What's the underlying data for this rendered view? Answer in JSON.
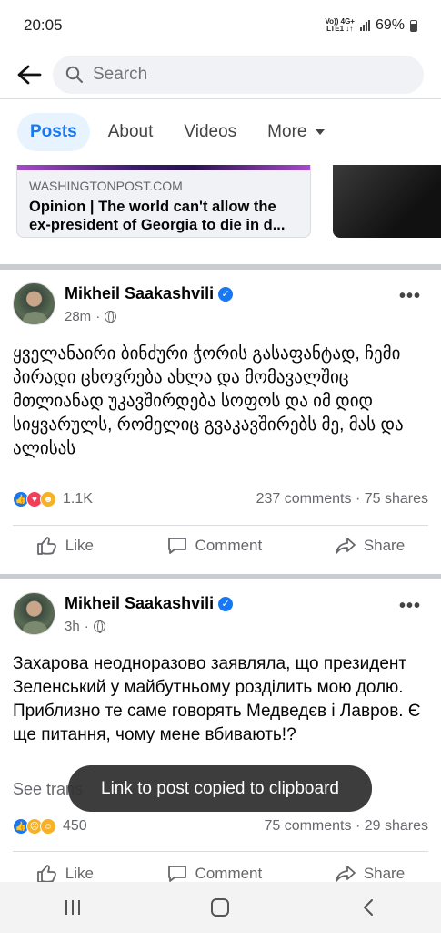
{
  "status_bar": {
    "time": "20:05",
    "network_top": "Vo)) 4G+",
    "network_bottom": "LTE1 ↓↑",
    "battery": "69%"
  },
  "search": {
    "placeholder": "Search"
  },
  "tabs": [
    {
      "label": "Posts",
      "active": true
    },
    {
      "label": "About"
    },
    {
      "label": "Videos"
    },
    {
      "label": "More"
    }
  ],
  "link_card": {
    "domain": "WASHINGTONPOST.COM",
    "title": "Opinion | The world can't allow the ex-president of Georgia to die in d..."
  },
  "posts": [
    {
      "author": "Mikheil Saakashvili",
      "time": "28m",
      "text": "ყველანაირი ბინძური ჭორის გასაფანტად, ჩემი პირადი ცხოვრება ახლა და მომავალშიც მთლიანად უკავშირდება სოფოს და იმ დიდ სიყვარულს, რომელიც გვაკავშირებს მე, მას და ალისას",
      "reactions_count": "1.1K",
      "comments": "237 comments",
      "shares": "75 shares"
    },
    {
      "author": "Mikheil Saakashvili",
      "time": "3h",
      "text": "Захарова неодноразово заявляла, що президент Зеленський у майбутньому розділить мою долю. Приблизно те саме говорять Медведєв і Лавров. Є ще питання, чому мене вбивають!?",
      "see_translation": "See trans",
      "reactions_count": "450",
      "comments": "75 comments",
      "shares": "29 shares"
    }
  ],
  "actions": {
    "like": "Like",
    "comment": "Comment",
    "share": "Share"
  },
  "toast": "Link to post copied to clipboard",
  "colors": {
    "accent": "#1877f2",
    "separator": "#c9ccd1",
    "tab_active_bg": "#e7f3ff"
  }
}
